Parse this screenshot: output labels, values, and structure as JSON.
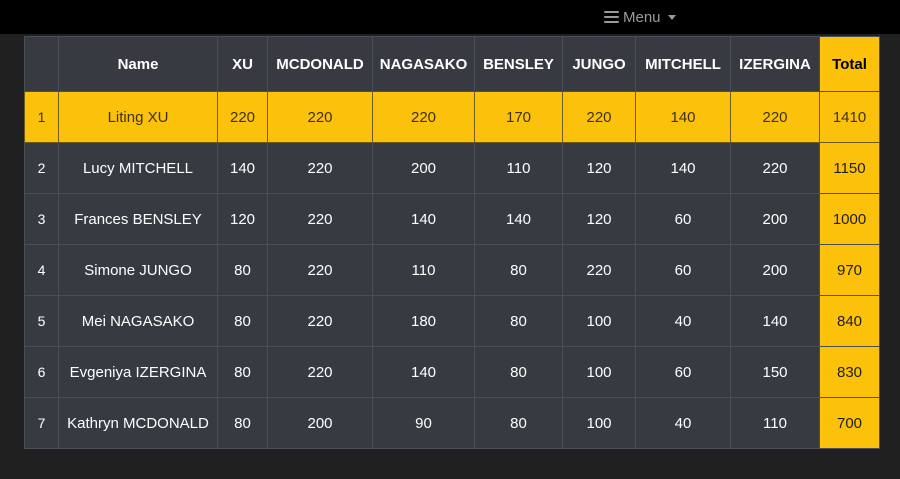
{
  "nav": {
    "menu_label": "Menu"
  },
  "colors": {
    "accent": "#fcc10b",
    "table_bg": "#363a41",
    "page_bg": "#202020",
    "topbar_bg": "#000000"
  },
  "table": {
    "headers": [
      "",
      "Name",
      "XU",
      "MCDONALD",
      "NAGASAKO",
      "BENSLEY",
      "JUNGO",
      "MITCHELL",
      "IZERGINA",
      "Total"
    ],
    "rows": [
      [
        "1",
        "Liting XU",
        "220",
        "220",
        "220",
        "170",
        "220",
        "140",
        "220",
        "1410"
      ],
      [
        "2",
        "Lucy MITCHELL",
        "140",
        "220",
        "200",
        "110",
        "120",
        "140",
        "220",
        "1150"
      ],
      [
        "3",
        "Frances BENSLEY",
        "120",
        "220",
        "140",
        "140",
        "120",
        "60",
        "200",
        "1000"
      ],
      [
        "4",
        "Simone JUNGO",
        "80",
        "220",
        "110",
        "80",
        "220",
        "60",
        "200",
        "970"
      ],
      [
        "5",
        "Mei NAGASAKO",
        "80",
        "220",
        "180",
        "80",
        "100",
        "40",
        "140",
        "840"
      ],
      [
        "6",
        "Evgeniya IZERGINA",
        "80",
        "220",
        "140",
        "80",
        "100",
        "60",
        "150",
        "830"
      ],
      [
        "7",
        "Kathryn MCDONALD",
        "80",
        "200",
        "90",
        "80",
        "100",
        "40",
        "110",
        "700"
      ]
    ]
  }
}
